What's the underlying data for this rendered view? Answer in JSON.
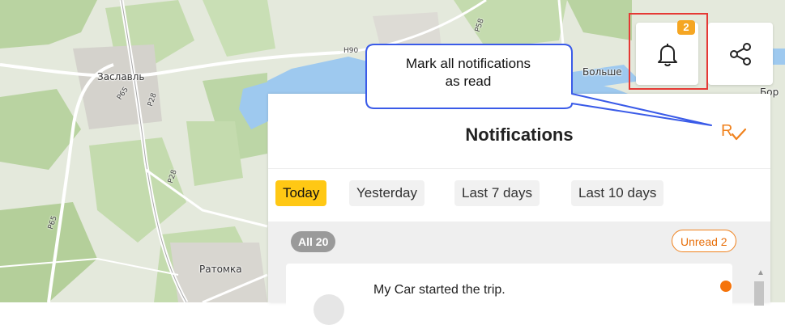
{
  "map": {
    "places": {
      "zaslavl": "Заславль",
      "ratomka": "Ратомка",
      "bolshe": "Больше",
      "h90": "Н90",
      "r65a": "Р65",
      "r28a": "Р28",
      "r28b": "Р28",
      "r65b": "Р65",
      "r58": "Р58",
      "bor": "Бор"
    }
  },
  "toolbar": {
    "bell_icon": "bell-icon",
    "share_icon": "share-icon",
    "bell_badge": "2"
  },
  "callout": {
    "text_line1": "Mark all notifications",
    "text_line2": "as read"
  },
  "panel": {
    "title": "Notifications",
    "mark_read_icon": "mark-all-read-icon",
    "mark_read_color": "#f0821e",
    "filters": [
      {
        "label": "Today",
        "active": true
      },
      {
        "label": "Yesterday",
        "active": false
      },
      {
        "label": "Last 7 days",
        "active": false
      },
      {
        "label": "Last 10 days",
        "active": false
      }
    ],
    "all_count_label": "All 20",
    "unread_label": "Unread 2",
    "notifications": [
      {
        "text": "My Car started the trip.",
        "unread": true
      }
    ]
  },
  "colors": {
    "accent_yellow": "#ffc814",
    "badge_orange": "#f5a623",
    "unread_orange": "#f5730a",
    "highlight_red": "#e53935",
    "callout_blue": "#3a5be8"
  }
}
